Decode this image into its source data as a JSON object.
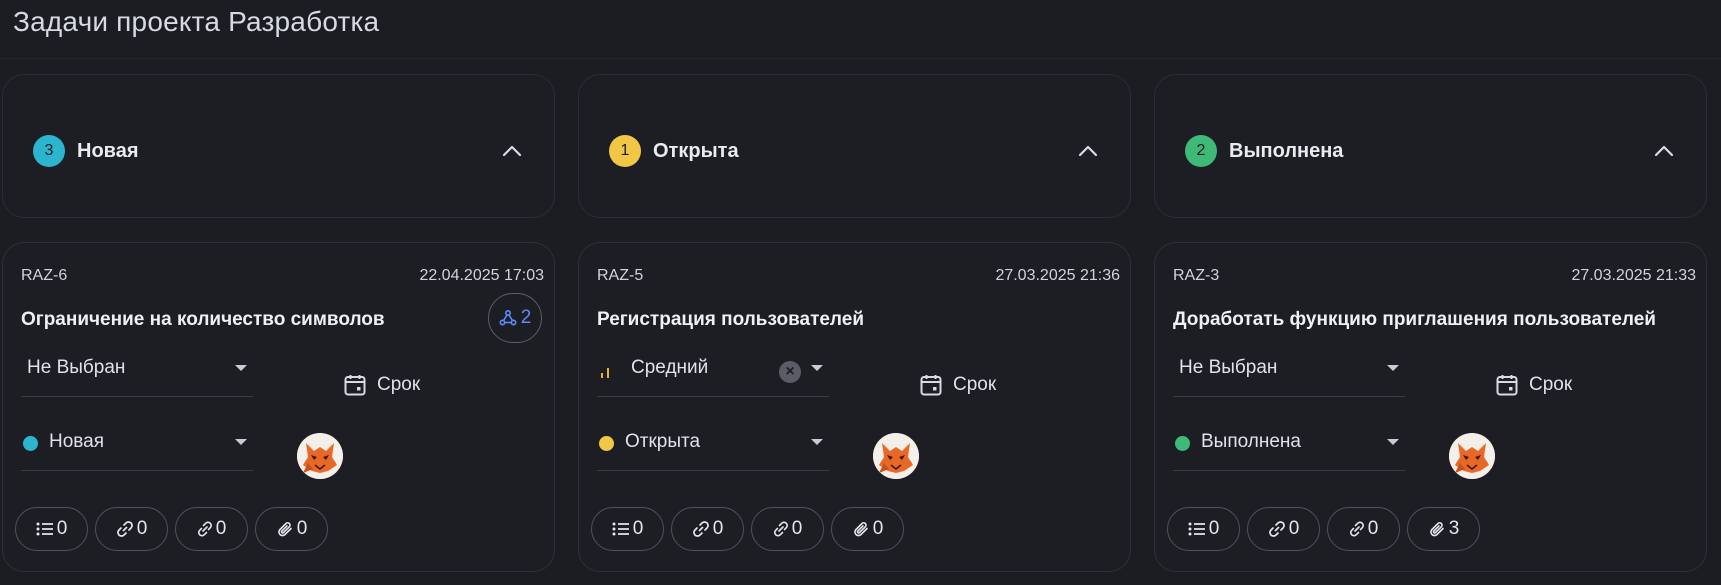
{
  "page": {
    "title": "Задачи проекта Разработка"
  },
  "colors": {
    "new": "#2bb5cf",
    "open": "#f1c745",
    "done": "#3fb978",
    "subtask_accent": "#5b8cff",
    "priority_bars": "#e6b23a"
  },
  "columns": [
    {
      "count": "3",
      "title": "Новая",
      "color": "#2bb5cf",
      "card": {
        "id": "RAZ-6",
        "date": "22.04.2025 17:03",
        "title": "Ограничение на количество символов",
        "subtasks": "2",
        "priority": "Не Выбран",
        "due": "Срок",
        "status": "Новая",
        "counters": {
          "checklist": "0",
          "links": "0",
          "relations": "0",
          "attachments": "0"
        }
      }
    },
    {
      "count": "1",
      "title": "Открыта",
      "color": "#f1c745",
      "card": {
        "id": "RAZ-5",
        "date": "27.03.2025 21:36",
        "title": "Регистрация пользователей",
        "priority": "Средний",
        "due": "Срок",
        "status": "Открыта",
        "counters": {
          "checklist": "0",
          "links": "0",
          "relations": "0",
          "attachments": "0"
        }
      }
    },
    {
      "count": "2",
      "title": "Выполнена",
      "color": "#3fb978",
      "card": {
        "id": "RAZ-3",
        "date": "27.03.2025 21:33",
        "title": "Доработать функцию приглашения пользователей",
        "priority": "Не Выбран",
        "due": "Срок",
        "status": "Выполнена",
        "counters": {
          "checklist": "0",
          "links": "0",
          "relations": "0",
          "attachments": "3"
        }
      }
    }
  ],
  "icons": {
    "collapse": "chevron-up-icon",
    "subtasks": "subtasks-icon",
    "calendar": "calendar-icon",
    "checklist": "checklist-icon",
    "link": "link-icon",
    "relation": "relation-icon",
    "attachment": "paperclip-icon",
    "clear": "clear-icon",
    "priority": "priority-bars-icon"
  }
}
